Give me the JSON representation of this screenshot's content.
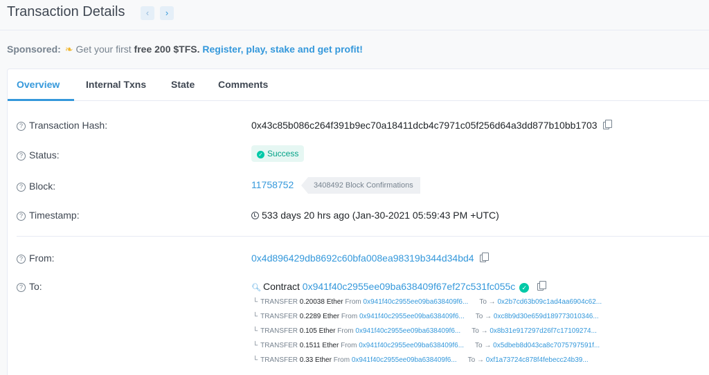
{
  "header": {
    "title": "Transaction Details",
    "prev_icon": "‹",
    "next_icon": "›"
  },
  "sponsored": {
    "label": "Sponsored:",
    "icon": "coin-icon",
    "text": "Get your first",
    "bold": "free 200 $TFS.",
    "link": "Register, play, stake and get profit!"
  },
  "tabs": [
    "Overview",
    "Internal Txns",
    "State",
    "Comments"
  ],
  "fields": {
    "hash": {
      "label": "Transaction Hash:",
      "value": "0x43c85b086c264f391b9ec70a18411dcb4c7971c05f256d64a3dd877b10bb1703"
    },
    "status": {
      "label": "Status:",
      "value": "Success"
    },
    "block": {
      "label": "Block:",
      "value": "11758752",
      "confirmations": "3408492 Block Confirmations"
    },
    "timestamp": {
      "label": "Timestamp:",
      "value": "533 days 20 hrs ago (Jan-30-2021 05:59:43 PM +UTC)"
    },
    "from": {
      "label": "From:",
      "value": "0x4d896429db8692c60bfa008ea98319b344d34bd4"
    },
    "to": {
      "label": "To:",
      "prefix": "Contract",
      "value": "0x941f40c2955ee09ba638409f67ef27c531fc055c"
    }
  },
  "transfers": [
    {
      "type": "TRANSFER",
      "amount": "0.20038 Ether",
      "from_kw": "From",
      "from": "0x941f40c2955ee09ba638409f6...",
      "to_kw": "To",
      "to": "0x2b7cd63b09c1ad4aa6904c62..."
    },
    {
      "type": "TRANSFER",
      "amount": "0.2289 Ether",
      "from_kw": "From",
      "from": "0x941f40c2955ee09ba638409f6...",
      "to_kw": "To",
      "to": "0xc8b9d30e659d189773010346..."
    },
    {
      "type": "TRANSFER",
      "amount": "0.105 Ether",
      "from_kw": "From",
      "from": "0x941f40c2955ee09ba638409f6...",
      "to_kw": "To",
      "to": "0x8b31e917297d26f7c17109274..."
    },
    {
      "type": "TRANSFER",
      "amount": "0.1511 Ether",
      "from_kw": "From",
      "from": "0x941f40c2955ee09ba638409f6...",
      "to_kw": "To",
      "to": "0x5dbeb8d043ca8c7075797591f..."
    },
    {
      "type": "TRANSFER",
      "amount": "0.33 Ether",
      "from_kw": "From",
      "from": "0x941f40c2955ee09ba638409f6...",
      "to_kw": "To",
      "to": "0xf1a73724c878f4febecc24b39..."
    }
  ],
  "colors": {
    "accent": "#3498db",
    "success": "#00c9a7",
    "text": "#3f4752"
  }
}
